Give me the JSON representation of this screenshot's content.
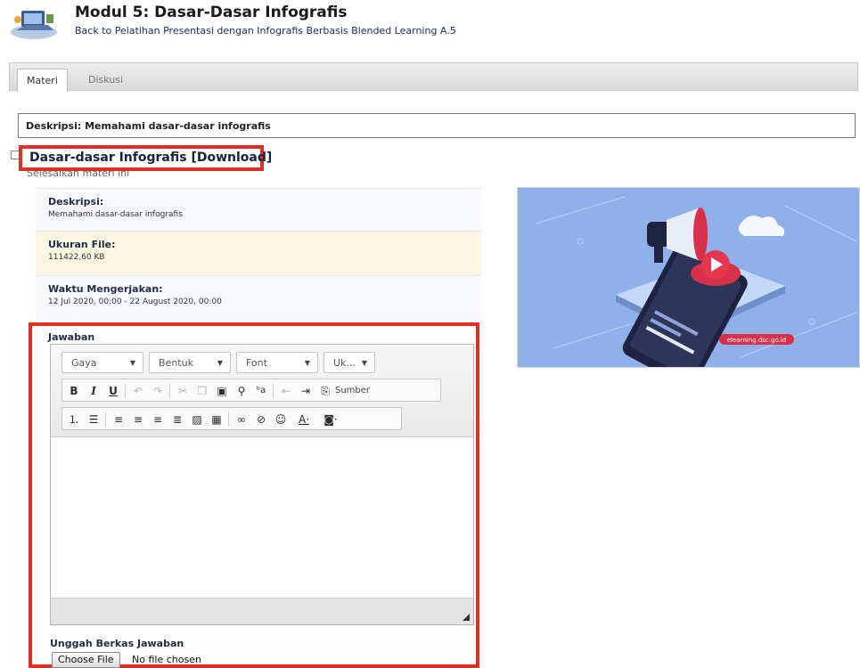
{
  "header": {
    "title": "Modul 5: Dasar-Dasar Infografis",
    "back_link": "Back to Pelatihan Presentasi dengan Infografis Berbasis Blended Learning A.5"
  },
  "tabs": [
    {
      "label": "Materi",
      "active": true
    },
    {
      "label": "Diskusi",
      "active": false
    }
  ],
  "module_description": "Deskripsi: Memahami dasar-dasar infografis",
  "material": {
    "title": "Dasar-dasar Infografis",
    "download_label": "[Download]",
    "complete_label": "Selesaikan materi ini",
    "details": [
      {
        "label": "Deskripsi:",
        "value": "Memahami dasar-dasar infografis"
      },
      {
        "label": "Ukuran File:",
        "value": "111422,60 KB"
      },
      {
        "label": "Waktu Mengerjakan:",
        "value": "12 Jul 2020, 00:00 - 22 August 2020, 00:00"
      }
    ]
  },
  "answer": {
    "label": "Jawaban",
    "combos": [
      "Gaya",
      "Bentuk",
      "Font",
      "Uk..."
    ],
    "source_label": "Sumber",
    "editor_text": ""
  },
  "upload": {
    "label": "Unggah Berkas Jawaban",
    "button": "Choose File",
    "status": "No file chosen"
  },
  "hero_image": {
    "watermark": "elearning.dsc.go.id"
  },
  "colors": {
    "highlight_border": "#e03024",
    "link": "#1a2f6b",
    "hero_bg": "#8fb0e8"
  }
}
